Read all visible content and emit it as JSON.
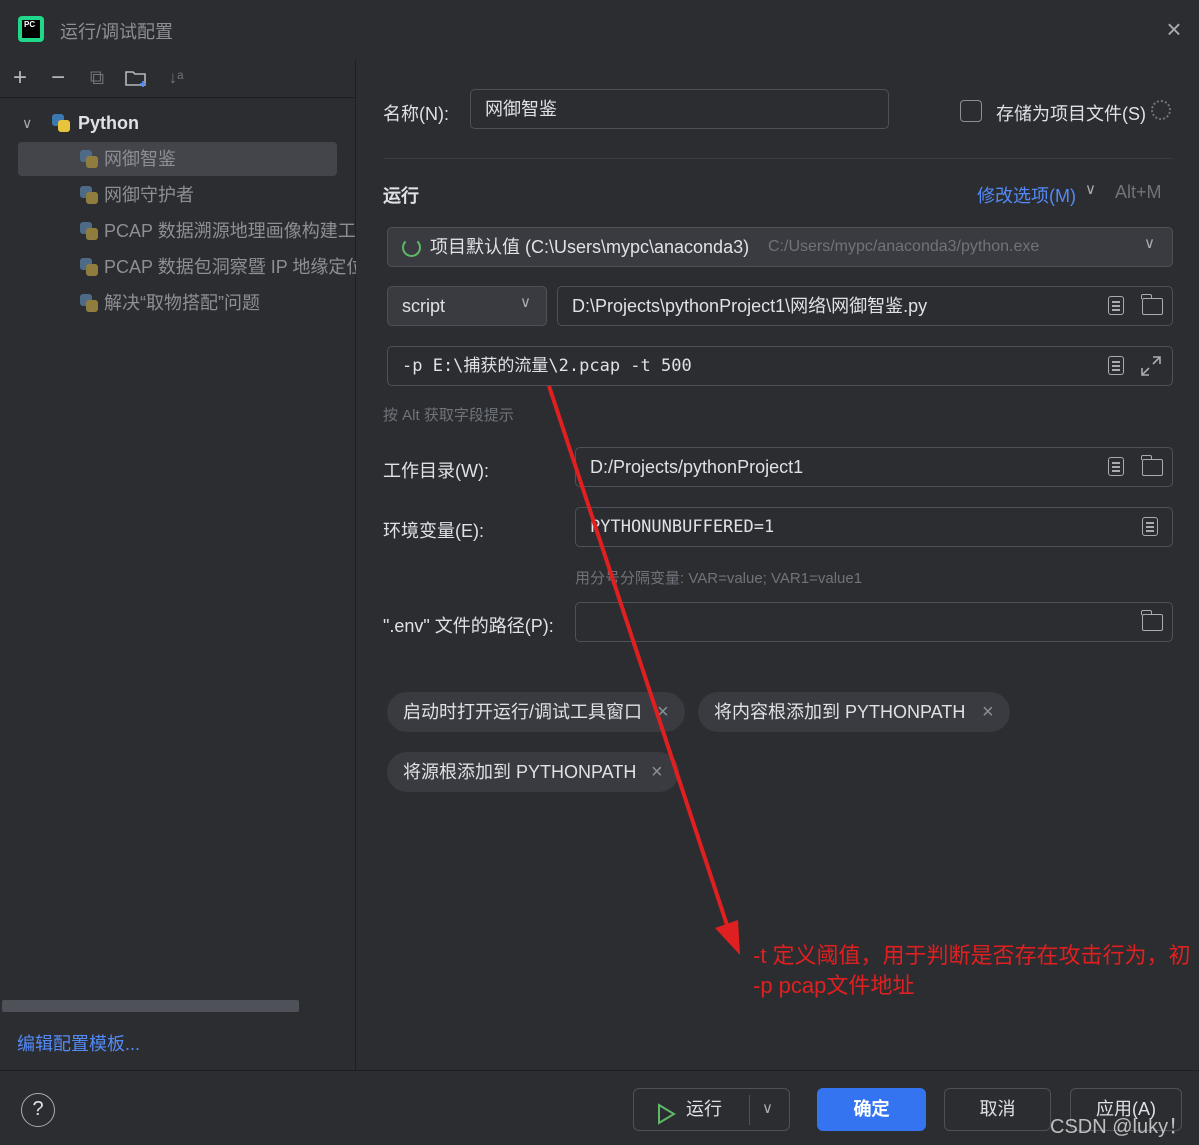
{
  "window": {
    "title": "运行/调试配置",
    "close_icon": "×"
  },
  "left_toolbar": {
    "add_icon": "+",
    "remove_icon": "−",
    "copy_icon": "⧉",
    "sort_icon": "↓ᵃ"
  },
  "tree": {
    "root_label": "Python",
    "items": [
      "网御智鉴",
      "网御守护者",
      "PCAP 数据溯源地理画像构建工",
      "PCAP 数据包洞察暨 IP 地缘定位",
      "解决“取物搭配”问题"
    ]
  },
  "edit_templates_link": "编辑配置模板...",
  "form": {
    "name_label": "名称(N):",
    "name_value": "网御智鉴",
    "store_checkbox_label": "存储为项目文件(S)",
    "store_checked": false,
    "run_section": "运行",
    "modify_options": "修改选项(M)",
    "modify_shortcut": "Alt+M",
    "interpreter_name": "项目默认值 (C:\\Users\\mypc\\anaconda3)",
    "interpreter_path": "C:/Users/mypc/anaconda3/python.exe",
    "script_mode": "script",
    "script_path": "D:\\Projects\\pythonProject1\\网络\\网御智鉴.py",
    "parameters": "-p E:\\捕获的流量\\2.pcap -t 500",
    "params_hint": "按 Alt 获取字段提示",
    "workdir_label": "工作目录(W):",
    "workdir_value": "D:/Projects/pythonProject1",
    "env_label": "环境变量(E):",
    "env_value": "PYTHONUNBUFFERED=1",
    "env_hint": "用分号分隔变量: VAR=value; VAR1=value1",
    "dotenv_label": "\".env\" 文件的路径(P):",
    "dotenv_value": "",
    "chips": [
      "启动时打开运行/调试工具窗口",
      "将内容根添加到 PYTHONPATH",
      "将源根添加到 PYTHONPATH"
    ]
  },
  "annotation": {
    "line1": "-t 定义阈值，用于判断是否存在攻击行为，初",
    "line2": "-p pcap文件地址",
    "color": "#e02020"
  },
  "buttons": {
    "help": "?",
    "run": "运行",
    "ok": "确定",
    "cancel": "取消",
    "apply": "应用(A)"
  },
  "watermark": "CSDN @luky！"
}
